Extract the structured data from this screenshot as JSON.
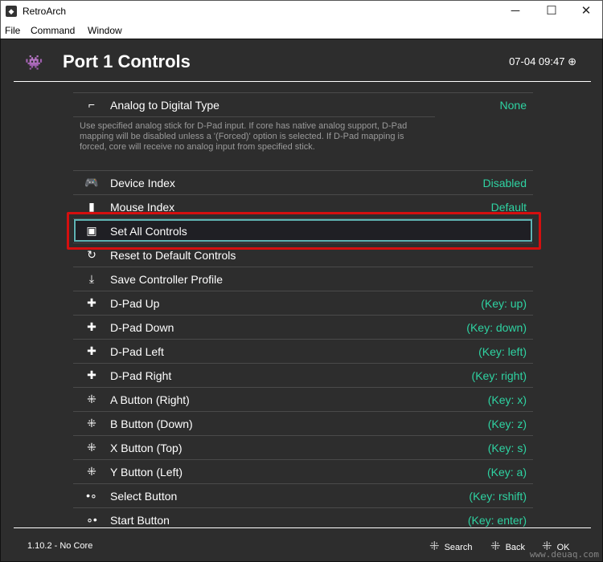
{
  "window": {
    "title": "RetroArch",
    "minimize": "─",
    "maximize": "☐",
    "close": "✕"
  },
  "menu": [
    "File",
    "Command",
    "Window"
  ],
  "header": {
    "title": "Port 1 Controls",
    "clock": "07-04 09:47"
  },
  "description": "Use specified analog stick for D-Pad input. If core has native analog support, D-Pad mapping will be disabled unless a '(Forced)' option is selected. If D-Pad mapping is forced, core will receive no analog input from specified stick.",
  "items": [
    {
      "icon": "analog-icon",
      "glyph": "⌐",
      "label": "Analog to Digital Type",
      "value": "None"
    },
    {
      "icon": "gamepad-icon",
      "glyph": "🎮",
      "label": "Device Index",
      "value": "Disabled"
    },
    {
      "icon": "mouse-icon",
      "glyph": "▮",
      "label": "Mouse Index",
      "value": "Default"
    },
    {
      "icon": "controller-save-icon",
      "glyph": "▣",
      "label": "Set All Controls",
      "value": "",
      "selected": true
    },
    {
      "icon": "reset-icon",
      "glyph": "↻",
      "label": "Reset to Default Controls",
      "value": ""
    },
    {
      "icon": "download-icon",
      "glyph": "⤓",
      "label": "Save Controller Profile",
      "value": ""
    },
    {
      "icon": "dpad-up-icon",
      "glyph": "✚",
      "label": "D-Pad Up",
      "value": "(Key: up)"
    },
    {
      "icon": "dpad-down-icon",
      "glyph": "✚",
      "label": "D-Pad Down",
      "value": "(Key: down)"
    },
    {
      "icon": "dpad-left-icon",
      "glyph": "✚",
      "label": "D-Pad Left",
      "value": "(Key: left)"
    },
    {
      "icon": "dpad-right-icon",
      "glyph": "✚",
      "label": "D-Pad Right",
      "value": "(Key: right)"
    },
    {
      "icon": "face-button-right-icon",
      "glyph": "⁜",
      "label": "A Button (Right)",
      "value": "(Key: x)"
    },
    {
      "icon": "face-button-down-icon",
      "glyph": "⁜",
      "label": "B Button (Down)",
      "value": "(Key: z)"
    },
    {
      "icon": "face-button-top-icon",
      "glyph": "⁜",
      "label": "X Button (Top)",
      "value": "(Key: s)"
    },
    {
      "icon": "face-button-left-icon",
      "glyph": "⁜",
      "label": "Y Button (Left)",
      "value": "(Key: a)"
    },
    {
      "icon": "select-icon",
      "glyph": "•∘",
      "label": "Select Button",
      "value": "(Key: rshift)"
    },
    {
      "icon": "start-icon",
      "glyph": "∘•",
      "label": "Start Button",
      "value": "(Key: enter)"
    }
  ],
  "footer": {
    "version": "1.10.2 - No Core",
    "search": "Search",
    "back": "Back",
    "ok": "OK"
  },
  "watermark": "www.deuaq.com",
  "colors": {
    "value": "#2ed3a2",
    "background": "#2d2d2d",
    "selection_border": "#5fb3b3",
    "annotation": "#d40f0f"
  }
}
